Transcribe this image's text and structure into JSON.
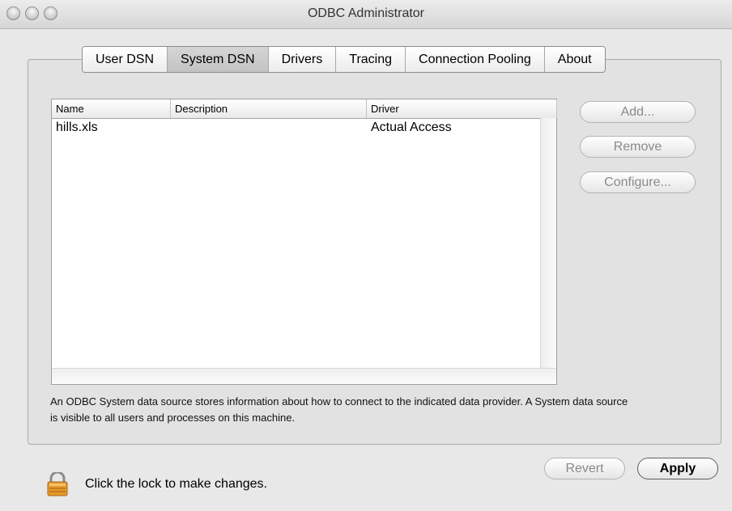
{
  "window": {
    "title": "ODBC Administrator"
  },
  "tabs": [
    {
      "label": "User DSN",
      "selected": false
    },
    {
      "label": "System DSN",
      "selected": true
    },
    {
      "label": "Drivers",
      "selected": false
    },
    {
      "label": "Tracing",
      "selected": false
    },
    {
      "label": "Connection Pooling",
      "selected": false
    },
    {
      "label": "About",
      "selected": false
    }
  ],
  "table": {
    "columns": [
      "Name",
      "Description",
      "Driver"
    ],
    "rows": [
      {
        "name": "hills.xls",
        "description": "",
        "driver": "Actual Access"
      }
    ]
  },
  "buttons": {
    "add": "Add...",
    "remove": "Remove",
    "configure": "Configure...",
    "revert": "Revert",
    "apply": "Apply"
  },
  "description": "An ODBC System data source stores information about how to connect to the indicated data provider. A System data source is visible to all users and processes on this machine.",
  "lock": {
    "text": "Click the lock to make changes.",
    "icon": "lock-icon"
  }
}
